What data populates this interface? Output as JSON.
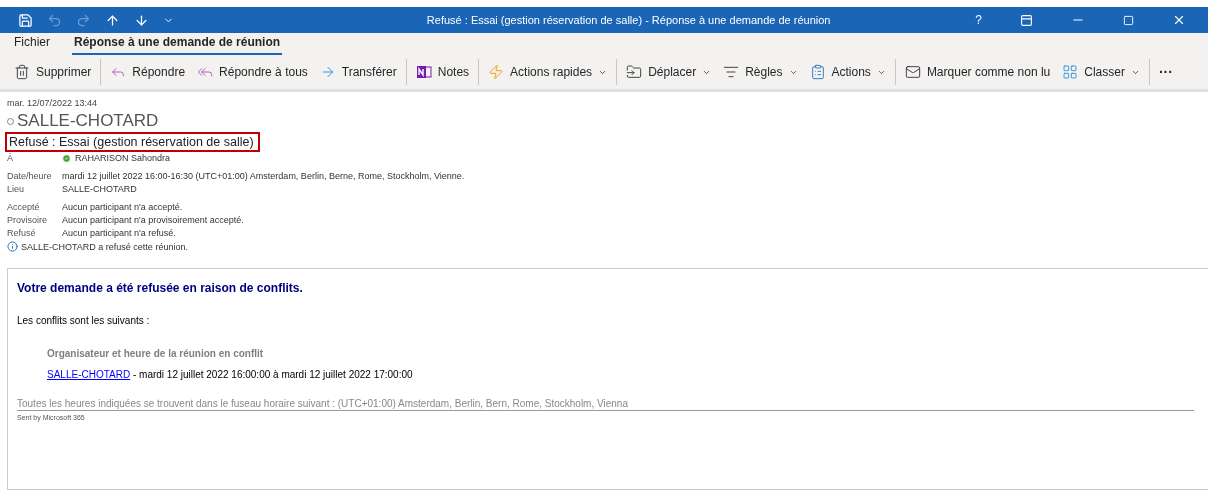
{
  "window": {
    "title": "Refusé : Essai (gestion réservation de salle)  -  Réponse à une demande de réunion",
    "quick_access": [
      {
        "disabled": false
      },
      {
        "disabled": true
      },
      {
        "disabled": true
      },
      {
        "disabled": false
      },
      {
        "disabled": false
      },
      {
        "disabled": false
      }
    ],
    "help": "?"
  },
  "tabs": [
    {
      "label": "Fichier",
      "selected": false
    },
    {
      "label": "Réponse à une demande de réunion",
      "selected": true
    }
  ],
  "toolbar": [
    {
      "kind": "button",
      "label": "Supprimer",
      "dropdown": false
    },
    {
      "kind": "separator"
    },
    {
      "kind": "button",
      "label": "Répondre",
      "dropdown": false
    },
    {
      "kind": "button",
      "label": "Répondre à tous",
      "dropdown": false
    },
    {
      "kind": "button",
      "label": "Transférer",
      "dropdown": false
    },
    {
      "kind": "separator"
    },
    {
      "kind": "button",
      "label": "Notes",
      "dropdown": false
    },
    {
      "kind": "separator"
    },
    {
      "kind": "button",
      "label": "Actions rapides",
      "dropdown": true
    },
    {
      "kind": "separator"
    },
    {
      "kind": "button",
      "label": "Déplacer",
      "dropdown": true
    },
    {
      "kind": "button",
      "label": "Règles",
      "dropdown": true
    },
    {
      "kind": "button",
      "label": "Actions",
      "dropdown": true
    },
    {
      "kind": "separator"
    },
    {
      "kind": "button",
      "label": "Marquer comme non lu",
      "dropdown": false
    },
    {
      "kind": "button",
      "label": "Classer",
      "dropdown": true
    },
    {
      "kind": "separator"
    },
    {
      "kind": "more",
      "label": "···"
    }
  ],
  "message": {
    "date": "mar. 12/07/2022 13:44",
    "sender": "SALLE-CHOTARD",
    "subject": "Refusé : Essai (gestion réservation de salle)",
    "subject_highlighted": true,
    "to_label": "À",
    "to": "RAHARISON Sahondra",
    "details": [
      {
        "label": "Date/heure",
        "value": "mardi 12 juillet 2022 16:00-16:30 (UTC+01:00) Amsterdam, Berlin, Berne, Rome, Stockholm, Vienne."
      },
      {
        "label": "Lieu",
        "value": "SALLE-CHOTARD"
      }
    ],
    "responses": [
      {
        "label": "Accepté",
        "value": "Aucun participant n'a accepté."
      },
      {
        "label": "Provisoire",
        "value": "Aucun participant n'a provisoirement accepté."
      },
      {
        "label": "Refusé",
        "value": "Aucun participant n'a refusé."
      }
    ],
    "info": "SALLE-CHOTARD a refusé cette réunion."
  },
  "body": {
    "heading": "Votre demande a été refusée en raison de conflits.",
    "intro": "Les conflits sont les suivants :",
    "conflict_heading": "Organisateur et heure de la réunion en conflit",
    "conflict_link": "SALLE-CHOTARD",
    "conflict_text": " - mardi 12 juillet 2022 16:00:00 à mardi 12 juillet 2022 17:00:00",
    "timezone_note": "Toutes les heures indiquées se trouvent dans le fuseau horaire suivant : (UTC+01:00) Amsterdam, Berlin, Bern, Rome, Stockholm, Vienna",
    "signature": "Sent by Microsoft 365"
  }
}
